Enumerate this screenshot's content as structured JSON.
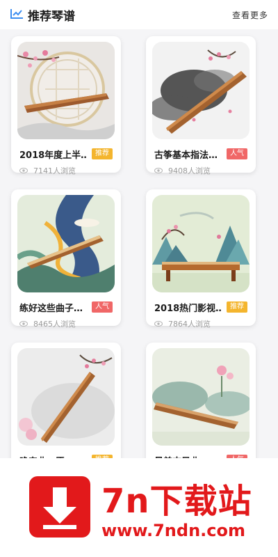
{
  "header": {
    "title": "推荐琴谱",
    "more_label": "查看更多",
    "icon": "list-chart-icon",
    "icon_color": "#3c8df0"
  },
  "cards": [
    {
      "title": "2018年度上半…",
      "badge": "推荐",
      "badge_type": "rec",
      "views": "7141人浏览",
      "image": "window-zither-illustration"
    },
    {
      "title": "古筝基本指法…",
      "badge": "人气",
      "badge_type": "pop",
      "views": "9408人浏览",
      "image": "ink-zither-illustration"
    },
    {
      "title": "练好这些曲子…",
      "badge": "人气",
      "badge_type": "pop",
      "views": "8465人浏览",
      "image": "river-zither-illustration"
    },
    {
      "title": "2018热门影视…",
      "badge": "推荐",
      "badge_type": "rec",
      "views": "7864人浏览",
      "image": "mountain-zither-illustration"
    },
    {
      "title": "晚安曲，愿一…",
      "badge": "推荐",
      "badge_type": "rec",
      "views": "",
      "image": "blossom-zither-illustration"
    },
    {
      "title": "最美古风曲…",
      "badge": "人气",
      "badge_type": "pop",
      "views": "",
      "image": "lotus-zither-illustration"
    }
  ],
  "banner": {
    "title": "7n下载站",
    "url": "www.7ndn.com",
    "color": "#e2191b"
  },
  "colors": {
    "recommend_badge": "#f4b52e",
    "popular_badge": "#f06767"
  }
}
